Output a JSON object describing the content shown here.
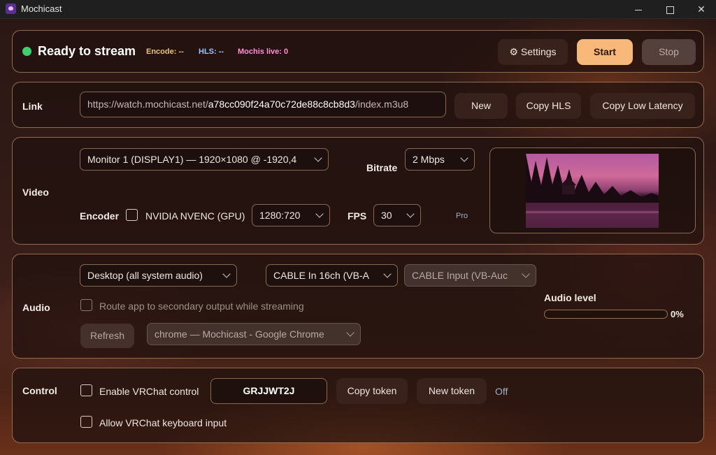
{
  "app": {
    "title": "Mochicast"
  },
  "status": {
    "headline": "Ready to stream",
    "encode": "Encode: --",
    "hls": "HLS: --",
    "mochis": "Mochis live: 0",
    "settings_label": "⚙ Settings",
    "start_label": "Start",
    "stop_label": "Stop",
    "colors": {
      "indicator": "#3ecf6e",
      "encode": "#e8c27a",
      "hls": "#9ec5ff",
      "mochis": "#ff8fd8"
    }
  },
  "link": {
    "label": "Link",
    "url_prefix": "https://watch.mochicast.net/",
    "url_token": "a78cc090f24a70c72de88c8cb8d3",
    "url_suffix": "/index.m3u8",
    "new_label": "New",
    "copy_hls_label": "Copy HLS",
    "copy_low_latency_label": "Copy Low Latency"
  },
  "video": {
    "label": "Video",
    "monitor_value": "Monitor 1 (DISPLAY1) — 1920×1080 @ -1920,4",
    "bitrate_label": "Bitrate",
    "bitrate_value": "2 Mbps",
    "encoder_label": "Encoder",
    "encoder_option": "NVIDIA NVENC (GPU)",
    "resolution_value": "1280:720",
    "fps_label": "FPS",
    "fps_value": "30",
    "pro_label": "Pro"
  },
  "audio": {
    "label": "Audio",
    "source_value": "Desktop (all system audio)",
    "output_value": "CABLE In 16ch (VB-A",
    "secondary_value": "CABLE Input (VB-Auc",
    "route_label": "Route app to secondary output while streaming",
    "refresh_label": "Refresh",
    "app_value": "chrome — Mochicast - Google Chrome",
    "level_label": "Audio level",
    "level_value": "0%",
    "level_fraction": 0
  },
  "control": {
    "label": "Control",
    "enable_label": "Enable VRChat control",
    "token_value": "GRJJWT2J",
    "copy_token_label": "Copy token",
    "new_token_label": "New token",
    "state_label": "Off",
    "keyboard_label": "Allow VRChat keyboard input"
  }
}
